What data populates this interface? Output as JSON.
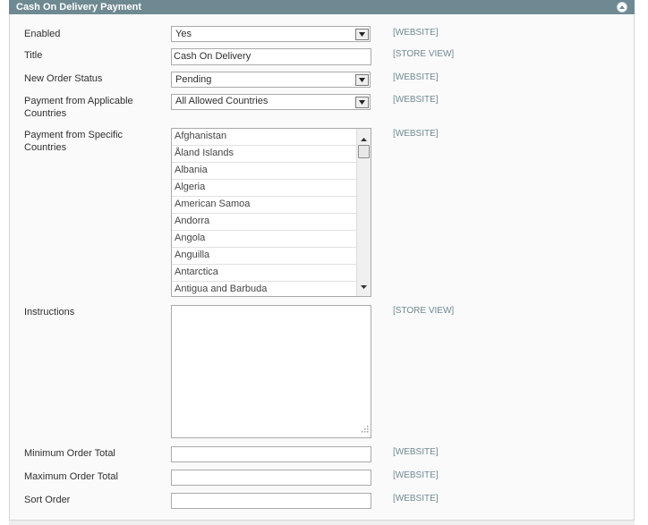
{
  "section": {
    "title": "Cash On Delivery Payment",
    "collapse_icon": "collapse-up-icon"
  },
  "fields": {
    "enabled": {
      "label": "Enabled",
      "value": "Yes",
      "scope": "[WEBSITE]"
    },
    "title": {
      "label": "Title",
      "value": "Cash On Delivery",
      "scope": "[STORE VIEW]"
    },
    "new_order_status": {
      "label": "New Order Status",
      "value": "Pending",
      "scope": "[WEBSITE]"
    },
    "applicable_countries": {
      "label": "Payment from Applicable Countries",
      "value": "All Allowed Countries",
      "scope": "[WEBSITE]"
    },
    "specific_countries": {
      "label": "Payment from Specific Countries",
      "scope": "[WEBSITE]",
      "options": [
        "Afghanistan",
        "Åland Islands",
        "Albania",
        "Algeria",
        "American Samoa",
        "Andorra",
        "Angola",
        "Anguilla",
        "Antarctica",
        "Antigua and Barbuda"
      ]
    },
    "instructions": {
      "label": "Instructions",
      "value": "",
      "scope": "[STORE VIEW]"
    },
    "min_order_total": {
      "label": "Minimum Order Total",
      "value": "",
      "scope": "[WEBSITE]"
    },
    "max_order_total": {
      "label": "Maximum Order Total",
      "value": "",
      "scope": "[WEBSITE]"
    },
    "sort_order": {
      "label": "Sort Order",
      "value": "",
      "scope": "[WEBSITE]"
    }
  },
  "colors": {
    "header": "#6f8992",
    "scope_text": "#6f8992",
    "panel_bg": "#fafafa"
  }
}
